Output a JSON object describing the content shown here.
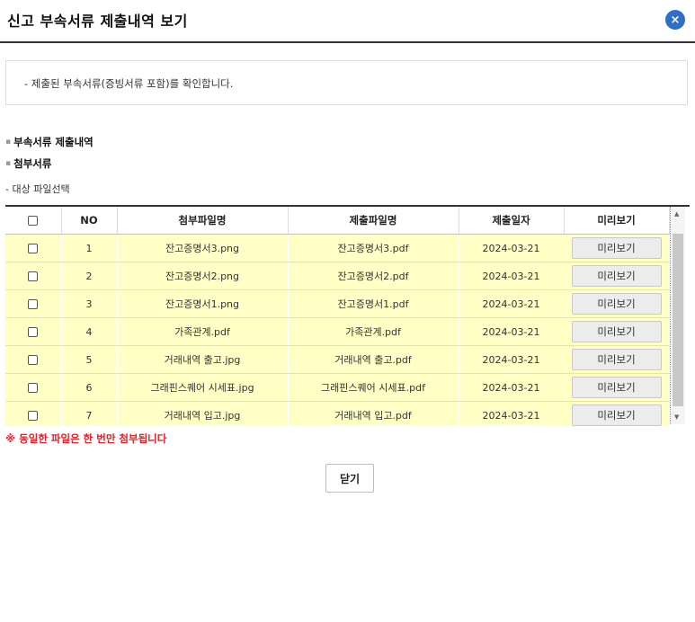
{
  "header": {
    "title": "신고 부속서류 제출내역 보기",
    "close_icon": "×"
  },
  "info": {
    "text": "- 제출된 부속서류(증빙서류 포함)를 확인합니다."
  },
  "sections": {
    "attachment_history": "부속서류 제출내역",
    "attachments": "첨부서류"
  },
  "sub_label": "- 대상 파일선택",
  "table": {
    "headers": [
      "NO",
      "첨부파일명",
      "제출파일명",
      "제출일자",
      "미리보기"
    ],
    "rows": [
      {
        "no": "1",
        "attach": "잔고증명서3.png",
        "submit": "잔고증명서3.pdf",
        "date": "2024-03-21",
        "preview": "미리보기"
      },
      {
        "no": "2",
        "attach": "잔고증명서2.png",
        "submit": "잔고증명서2.pdf",
        "date": "2024-03-21",
        "preview": "미리보기"
      },
      {
        "no": "3",
        "attach": "잔고증명서1.png",
        "submit": "잔고증명서1.pdf",
        "date": "2024-03-21",
        "preview": "미리보기"
      },
      {
        "no": "4",
        "attach": "가족관계.pdf",
        "submit": "가족관계.pdf",
        "date": "2024-03-21",
        "preview": "미리보기"
      },
      {
        "no": "5",
        "attach": "거래내역 출고.jpg",
        "submit": "거래내역 출고.pdf",
        "date": "2024-03-21",
        "preview": "미리보기"
      },
      {
        "no": "6",
        "attach": "그래핀스퀘어 시세표.jpg",
        "submit": "그래핀스퀘어 시세표.pdf",
        "date": "2024-03-21",
        "preview": "미리보기"
      },
      {
        "no": "7",
        "attach": "거래내역 입고.jpg",
        "submit": "거래내역 입고.pdf",
        "date": "2024-03-21",
        "preview": "미리보기"
      }
    ]
  },
  "note": "※ 동일한 파일은 한 번만 첨부됩니다",
  "footer": {
    "close_label": "닫기"
  }
}
